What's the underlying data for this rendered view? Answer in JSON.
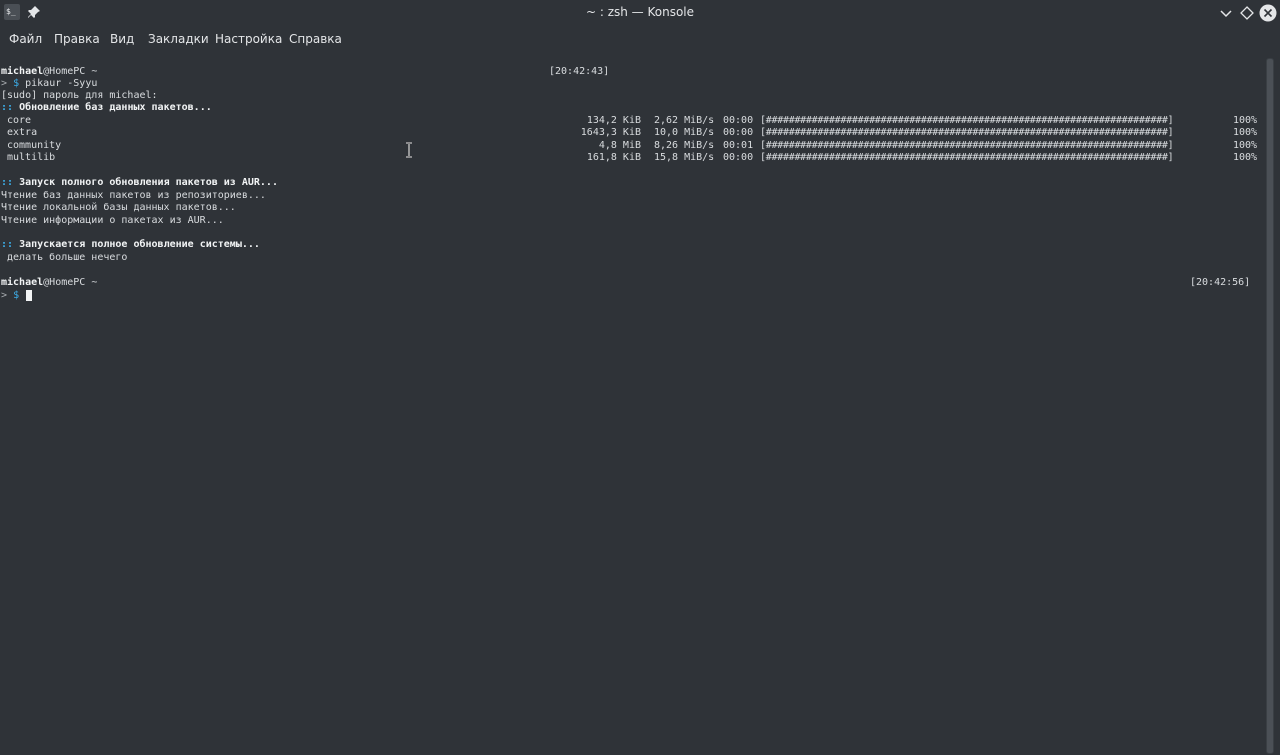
{
  "window": {
    "title": "~ : zsh — Konsole",
    "app_icon_text": "$_"
  },
  "menu": {
    "items": [
      "Файл",
      "Правка",
      "Вид",
      "Закладки",
      "Настройка",
      "Справка"
    ]
  },
  "terminal": {
    "prompt1": {
      "user": "michael",
      "host": "@HomePC ~",
      "time": "[20:42:43]"
    },
    "command": {
      "arrow": ">",
      "dollar": "$",
      "text": "pikaur -Syyu"
    },
    "sudo_line": "[sudo] пароль для michael:",
    "sync_header": {
      "prefix": "::",
      "text": "Обновление баз данных пакетов..."
    },
    "repos": [
      {
        "name": "core",
        "size": "134,2 KiB",
        "speed": "2,62 MiB/s",
        "time": "00:00",
        "bar": "[######################################################################]",
        "pct": "100%"
      },
      {
        "name": "extra",
        "size": "1643,3 KiB",
        "speed": "10,0 MiB/s",
        "time": "00:00",
        "bar": "[######################################################################]",
        "pct": "100%"
      },
      {
        "name": "community",
        "size": "4,8 MiB",
        "speed": "8,26 MiB/s",
        "time": "00:01",
        "bar": "[######################################################################]",
        "pct": "100%"
      },
      {
        "name": "multilib",
        "size": "161,8 KiB",
        "speed": "15,8 MiB/s",
        "time": "00:00",
        "bar": "[######################################################################]",
        "pct": "100%"
      }
    ],
    "aur_header": {
      "prefix": "::",
      "text": "Запуск полного обновления пакетов из AUR..."
    },
    "aur_lines": [
      "Чтение баз данных пакетов из репозиториев...",
      "Чтение локальной базы данных пакетов...",
      "Чтение информации о пакетах из AUR..."
    ],
    "sys_header": {
      "prefix": "::",
      "text": "Запускается полное обновление системы..."
    },
    "sys_line": " делать больше нечего",
    "prompt2": {
      "user": "michael",
      "host": "@HomePC ~",
      "time": "[20:42:56]"
    },
    "prompt2_cmd": {
      "arrow": ">",
      "dollar": "$"
    }
  },
  "colors": {
    "background": "#2f3338",
    "accent": "#3daee9",
    "text": "#d9dcdf"
  }
}
